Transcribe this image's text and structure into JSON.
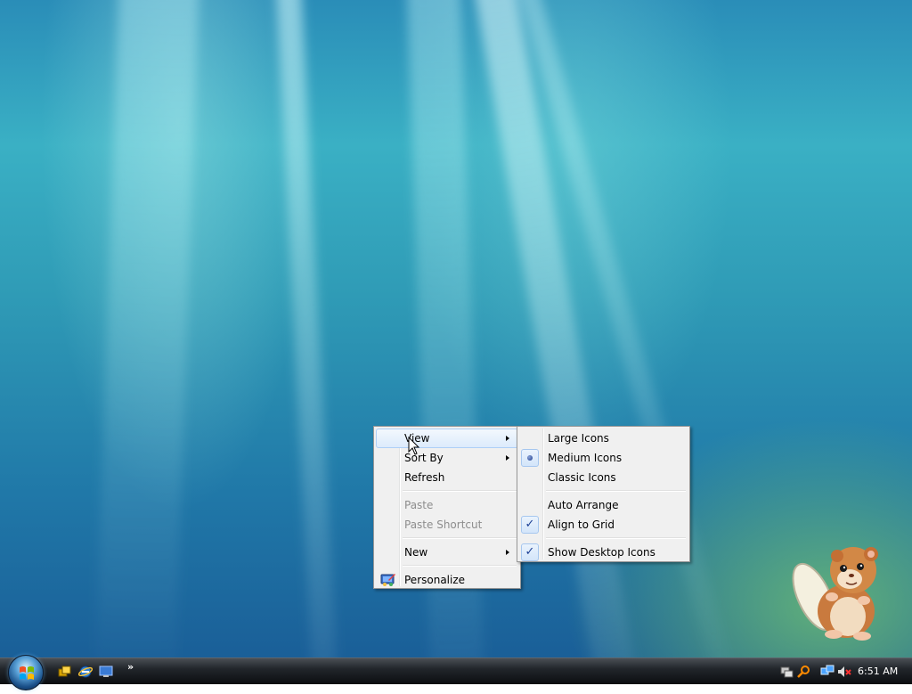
{
  "context_menu": {
    "items": [
      {
        "label": "View",
        "has_submenu": true,
        "highlighted": true,
        "disabled": false
      },
      {
        "label": "Sort By",
        "has_submenu": true,
        "highlighted": false,
        "disabled": false
      },
      {
        "label": "Refresh",
        "has_submenu": false,
        "highlighted": false,
        "disabled": false
      },
      {
        "label": "Paste",
        "has_submenu": false,
        "highlighted": false,
        "disabled": true
      },
      {
        "label": "Paste Shortcut",
        "has_submenu": false,
        "highlighted": false,
        "disabled": true
      },
      {
        "label": "New",
        "has_submenu": true,
        "highlighted": false,
        "disabled": false
      },
      {
        "label": "Personalize",
        "has_submenu": false,
        "highlighted": false,
        "disabled": false,
        "icon": "personalize-icon"
      }
    ]
  },
  "view_submenu": {
    "items": [
      {
        "label": "Large Icons",
        "mark": "none"
      },
      {
        "label": "Medium Icons",
        "mark": "radio"
      },
      {
        "label": "Classic Icons",
        "mark": "none"
      },
      {
        "label": "Auto Arrange",
        "mark": "none"
      },
      {
        "label": "Align to Grid",
        "mark": "check"
      },
      {
        "label": "Show Desktop Icons",
        "mark": "check"
      }
    ]
  },
  "taskbar": {
    "start_icon": "windows-orb-icon",
    "quick_launch": [
      "switch-windows-icon",
      "internet-explorer-icon",
      "show-desktop-icon"
    ],
    "overflow_label": "»",
    "tray_icons": [
      "network-icon",
      "search-icon",
      "network-monitor-icon",
      "volume-muted-icon"
    ],
    "clock": "6:51 AM"
  },
  "colors": {
    "menu_background": "#f0f0f0",
    "menu_highlight": "#dcebfc",
    "disabled_text": "#8d8d8d",
    "taskbar": "#0b0d10"
  }
}
